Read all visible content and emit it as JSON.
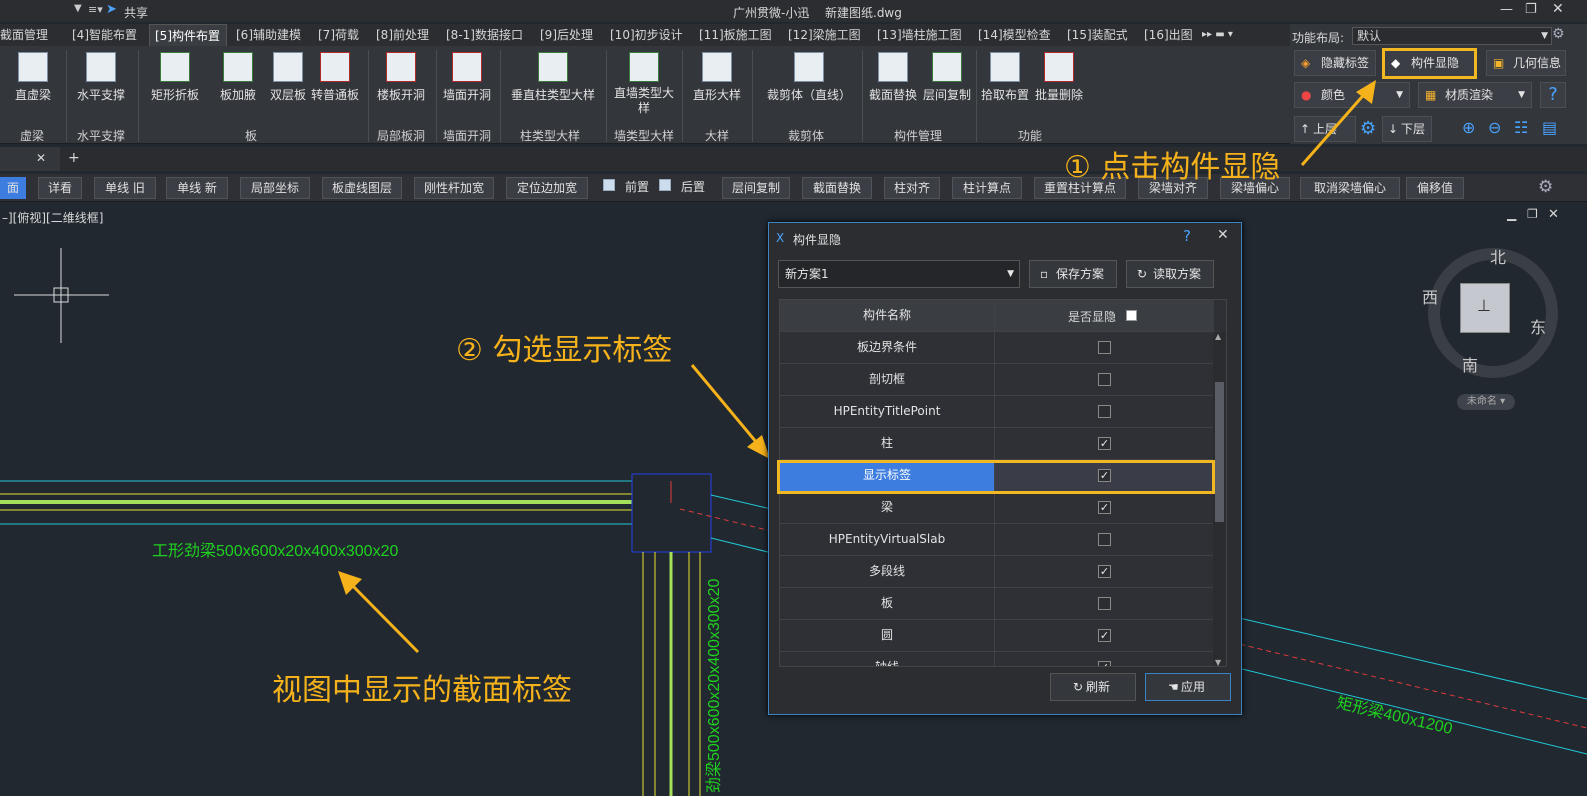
{
  "titlebar": {
    "share": "共享",
    "title": "广州贯微-小迅",
    "filename": "新建图纸.dwg"
  },
  "tabs": [
    "截面管理",
    "[4]智能布置",
    "[5]构件布置",
    "[6]辅助建模",
    "[7]荷载",
    "[8]前处理",
    "[8-1]数据接口",
    "[9]后处理",
    "[10]初步设计",
    "[11]板施工图",
    "[12]梁施工图",
    "[13]墙柱施工图",
    "[14]模型检查",
    "[15]装配式",
    "[16]出图"
  ],
  "ribbon": {
    "buttons": [
      "直虚梁",
      "水平支撑",
      "矩形折板",
      "板加腋",
      "双层板",
      "转普通板",
      "楼板开洞",
      "墙面开洞",
      "垂直柱类型大样",
      "直墙类型大样",
      "直形大样",
      "裁剪体（直线）",
      "截面替换",
      "层间复制",
      "拾取布置",
      "批量删除"
    ],
    "groups": [
      "虚梁",
      "水平支撑",
      "板",
      "局部板洞",
      "墙面开洞",
      "柱类型大样",
      "墙类型大样",
      "大样",
      "裁剪体",
      "构件管理",
      "功能"
    ]
  },
  "rightpanel": {
    "layout_label": "功能布局:",
    "layout_value": "默认",
    "hide_tag": "隐藏标签",
    "comp_toggle": "构件显隐",
    "geo_info": "几何信息",
    "color": "颜色",
    "material": "材质渲染",
    "up": "上层",
    "down": "下层"
  },
  "cmdbar": [
    "详看",
    "单线 旧",
    "单线 新",
    "局部坐标",
    "板虚线图层",
    "刚性杆加宽",
    "定位边加宽",
    "前置",
    "后置",
    "层间复制",
    "截面替换",
    "柱对齐",
    "柱计算点",
    "重置柱计算点",
    "梁墙对齐",
    "梁墙偏心",
    "取消梁墙偏心",
    "偏移值"
  ],
  "cmd_first": "面",
  "view_label": "–][俯视][二维线框]",
  "annotations": {
    "a1": "① 点击构件显隐",
    "a2": "② 勾选显示标签",
    "a3": "视图中显示的截面标签"
  },
  "cad": {
    "beam_h": "工形劲梁500x600x20x400x300x20",
    "beam_v": "劲梁500x600x20x400x300x20",
    "beam_r": "矩形梁400x1200"
  },
  "compass": {
    "n": "北",
    "s": "南",
    "e": "东",
    "w": "西",
    "name": "未命名"
  },
  "dialog": {
    "title": "构件显隐",
    "scheme": "新方案1",
    "save": "保存方案",
    "load": "读取方案",
    "col_name": "构件名称",
    "col_vis": "是否显隐",
    "rows": [
      {
        "name": "板边界条件",
        "checked": false
      },
      {
        "name": "剖切框",
        "checked": false
      },
      {
        "name": "HPEntityTitlePoint",
        "checked": false
      },
      {
        "name": "柱",
        "checked": true
      },
      {
        "name": "显示标签",
        "checked": true
      },
      {
        "name": "梁",
        "checked": true
      },
      {
        "name": "HPEntityVirtualSlab",
        "checked": false
      },
      {
        "name": "多段线",
        "checked": true
      },
      {
        "name": "板",
        "checked": false
      },
      {
        "name": "圆",
        "checked": true
      },
      {
        "name": "轴线",
        "checked": true
      }
    ],
    "refresh": "刷新",
    "apply": "应用"
  },
  "colors": {
    "accent": "#f5b21b",
    "highlight": "#f1b821",
    "select": "#3d7de0",
    "cad_green": "#1fd21f",
    "cad_cyan": "#21c9d8"
  }
}
